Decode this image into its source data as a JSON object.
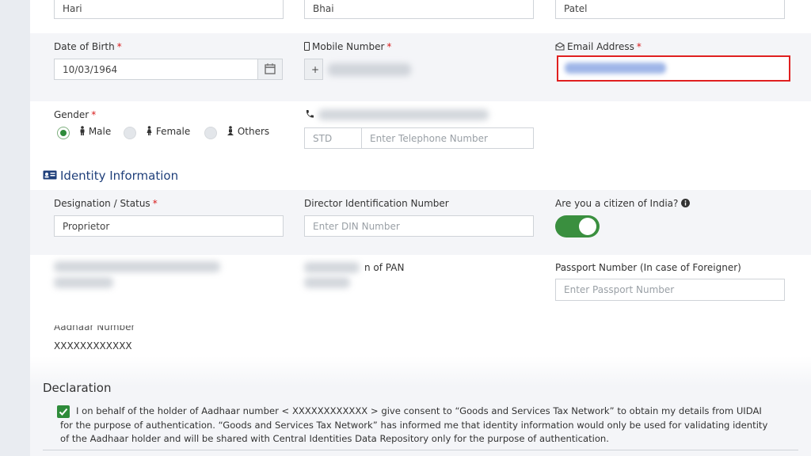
{
  "names": {
    "first": "Hari",
    "middle": "Bhai",
    "last": "Patel"
  },
  "dob": {
    "label": "Date of Birth",
    "value": "10/03/1964",
    "calendar_icon": "calendar-icon"
  },
  "mobile": {
    "label": "Mobile Number",
    "prefix": "+",
    "icon": "mobile-icon"
  },
  "email": {
    "label": "Email Address",
    "icon": "envelope-icon",
    "highlight_color": "#e02020"
  },
  "gender": {
    "label": "Gender",
    "options": [
      "Male",
      "Female",
      "Others"
    ],
    "selected": "Male"
  },
  "telephone": {
    "icon": "phone-icon",
    "std_placeholder": "STD",
    "number_placeholder": "Enter Telephone Number"
  },
  "identity": {
    "title": "Identity Information",
    "icon": "id-card-icon",
    "designation_label": "Designation / Status",
    "designation_value": "Proprietor",
    "din_label": "Director Identification Number",
    "din_placeholder": "Enter DIN Number",
    "citizen_label": "Are you a citizen of India?",
    "citizen_toggle": "on",
    "pan_label_visible": "n of PAN",
    "passport_label": "Passport Number (In case of Foreigner)",
    "passport_placeholder": "Enter Passport Number",
    "aadhaar_label": "Aadhaar Number",
    "aadhaar_value": "XXXXXXXXXXXX"
  },
  "declaration": {
    "title": "Declaration",
    "checked": true,
    "text": "I on behalf of the holder of Aadhaar number < XXXXXXXXXXXX > give consent to “Goods and Services Tax Network” to obtain my details from UIDAI for the purpose of authentication. “Goods and Services Tax Network” has informed me that identity information would only be used for validating identity of the Aadhaar holder and will be shared with Central Identities Data Repository only for the purpose of authentication."
  },
  "colors": {
    "accent_green": "#2e8b3a",
    "title_blue": "#1f3f7a",
    "required_red": "#d81b1b"
  }
}
